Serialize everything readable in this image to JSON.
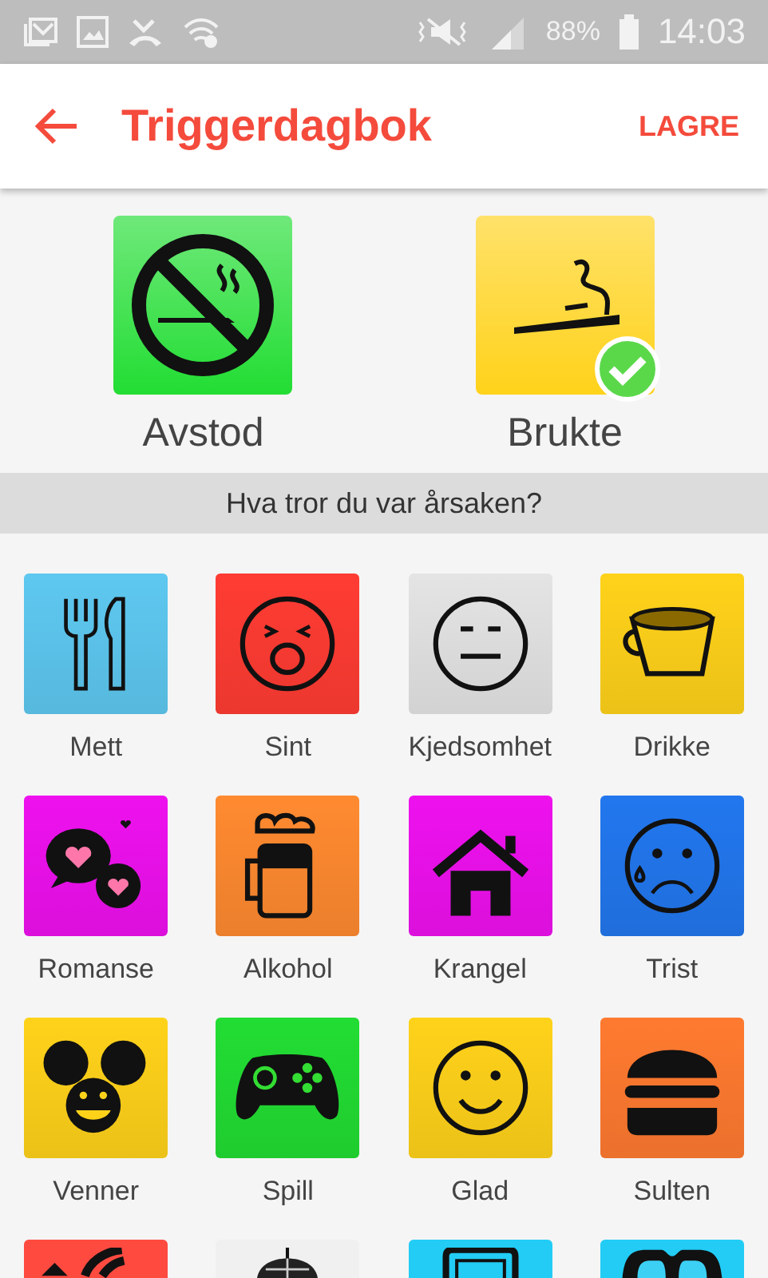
{
  "status_bar": {
    "battery": "88%",
    "time": "14:03"
  },
  "toolbar": {
    "title": "Triggerdagbok",
    "action": "LAGRE"
  },
  "outcomes": [
    {
      "label": "Avstod",
      "color": "#22dd33",
      "selected": false
    },
    {
      "label": "Brukte",
      "color": "#ffd21a",
      "selected": true
    }
  ],
  "section_header": "Hva tror du var årsaken?",
  "triggers": [
    {
      "label": "Mett",
      "color": "#5ec8f0"
    },
    {
      "label": "Sint",
      "color": "#ff3c33"
    },
    {
      "label": "Kjedsomhet",
      "color": "#e4e4e4"
    },
    {
      "label": "Drikke",
      "color": "#ffd21a"
    },
    {
      "label": "Romanse",
      "color": "#ee11ee"
    },
    {
      "label": "Alkohol",
      "color": "#ff8a30"
    },
    {
      "label": "Krangel",
      "color": "#ee11ee"
    },
    {
      "label": "Trist",
      "color": "#2277ee"
    },
    {
      "label": "Venner",
      "color": "#ffd21a"
    },
    {
      "label": "Spill",
      "color": "#22dd33"
    },
    {
      "label": "Glad",
      "color": "#ffd21a"
    },
    {
      "label": "Sulten",
      "color": "#ff7a30"
    },
    {
      "color": "#ff4a40"
    },
    {
      "color": "#f0f0f0"
    },
    {
      "color": "#22ccf5"
    },
    {
      "color": "#22ccf5"
    }
  ]
}
